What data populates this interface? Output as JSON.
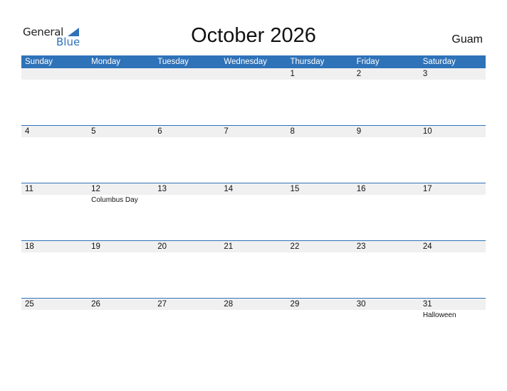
{
  "logo": {
    "general": "General",
    "blue": "Blue"
  },
  "title": "October 2026",
  "region": "Guam",
  "accent": "#2e72b8",
  "weekdays": [
    "Sunday",
    "Monday",
    "Tuesday",
    "Wednesday",
    "Thursday",
    "Friday",
    "Saturday"
  ],
  "weeks": [
    [
      {
        "d": ""
      },
      {
        "d": ""
      },
      {
        "d": ""
      },
      {
        "d": ""
      },
      {
        "d": "1"
      },
      {
        "d": "2"
      },
      {
        "d": "3"
      }
    ],
    [
      {
        "d": "4"
      },
      {
        "d": "5"
      },
      {
        "d": "6"
      },
      {
        "d": "7"
      },
      {
        "d": "8"
      },
      {
        "d": "9"
      },
      {
        "d": "10"
      }
    ],
    [
      {
        "d": "11"
      },
      {
        "d": "12",
        "e": "Columbus Day"
      },
      {
        "d": "13"
      },
      {
        "d": "14"
      },
      {
        "d": "15"
      },
      {
        "d": "16"
      },
      {
        "d": "17"
      }
    ],
    [
      {
        "d": "18"
      },
      {
        "d": "19"
      },
      {
        "d": "20"
      },
      {
        "d": "21"
      },
      {
        "d": "22"
      },
      {
        "d": "23"
      },
      {
        "d": "24"
      }
    ],
    [
      {
        "d": "25"
      },
      {
        "d": "26"
      },
      {
        "d": "27"
      },
      {
        "d": "28"
      },
      {
        "d": "29"
      },
      {
        "d": "30"
      },
      {
        "d": "31",
        "e": "Halloween"
      }
    ]
  ]
}
